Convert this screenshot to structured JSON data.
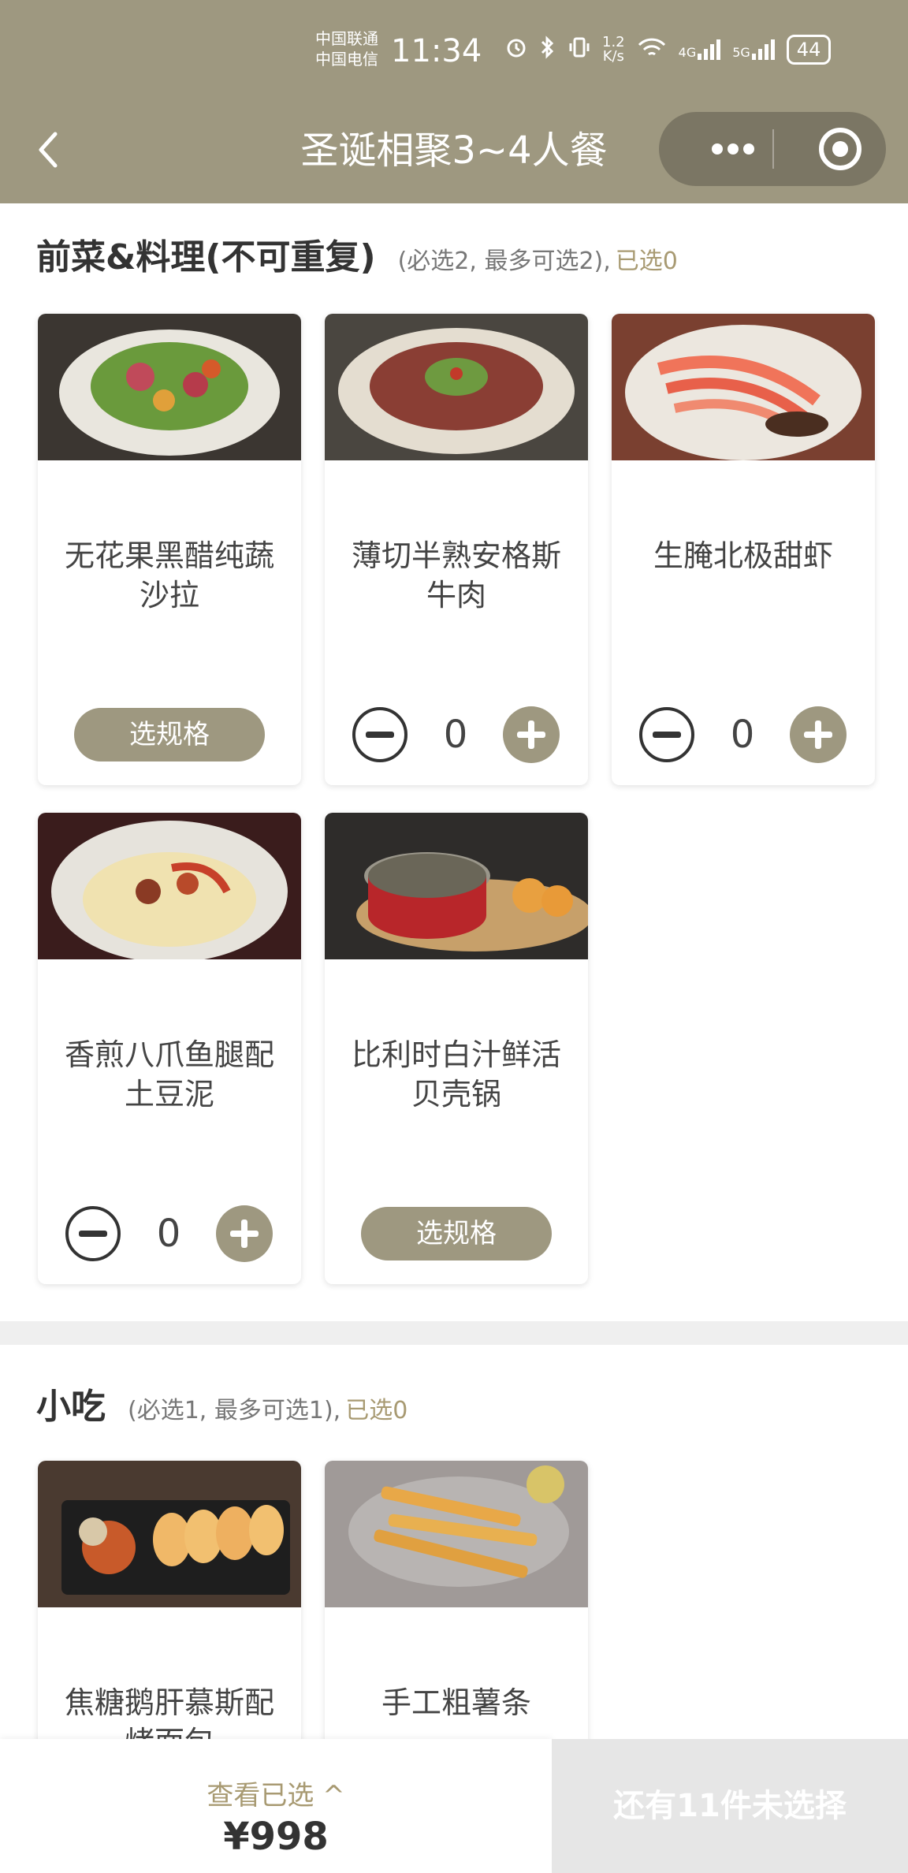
{
  "status_bar": {
    "carrier_1": "中国联通",
    "carrier_2": "中国电信",
    "time": "11:34",
    "network_speed_top": "1.2",
    "network_speed_bottom": "K/s",
    "sig1": "4G",
    "sig2": "5G",
    "battery": "44"
  },
  "header": {
    "title": "圣诞相聚3~4人餐",
    "back_icon": "chevron-left-icon",
    "more_icon": "more-dots-icon",
    "close_icon": "target-circle-icon"
  },
  "sections": [
    {
      "title": "前菜&料理(不可重复)",
      "rule": "(必选2, 最多可选2),",
      "selected": "已选0",
      "items": [
        {
          "name": "无花果黑醋纯蔬沙拉",
          "action": "spec",
          "spec_label": "选规格"
        },
        {
          "name": "薄切半熟安格斯牛肉",
          "action": "qty",
          "qty": "0"
        },
        {
          "name": "生腌北极甜虾",
          "action": "qty",
          "qty": "0"
        },
        {
          "name": "香煎八爪鱼腿配土豆泥",
          "action": "qty",
          "qty": "0"
        },
        {
          "name": "比利时白汁鲜活贝壳锅",
          "action": "spec",
          "spec_label": "选规格"
        }
      ]
    },
    {
      "title": "小吃",
      "rule": "(必选1, 最多可选1),",
      "selected": "已选0",
      "items": [
        {
          "name": "焦糖鹅肝慕斯配烤面包"
        },
        {
          "name": "手工粗薯条"
        }
      ]
    }
  ],
  "bottom_bar": {
    "view_selected": "查看已选 ^",
    "price": "¥998",
    "remaining": "还有11件未选择"
  },
  "colors": {
    "brand": "#9e9880",
    "accent_text": "#a89a72",
    "disabled": "#e6e6e6"
  }
}
